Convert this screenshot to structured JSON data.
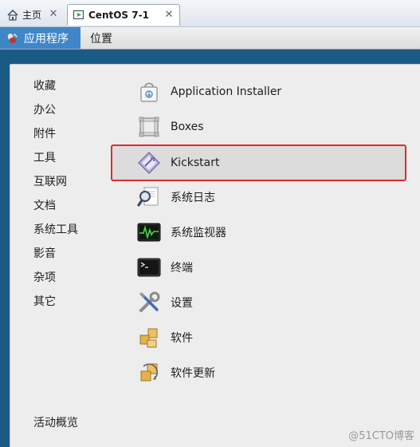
{
  "tabs": [
    {
      "label": "主页",
      "icon": "home-icon"
    },
    {
      "label": "CentOS 7-1",
      "icon": "vm-icon"
    }
  ],
  "topbar": {
    "applications_label": "应用程序",
    "places_label": "位置"
  },
  "categories": [
    "收藏",
    "办公",
    "附件",
    "工具",
    "互联网",
    "文档",
    "系统工具",
    "影音",
    "杂项",
    "其它"
  ],
  "activities_label": "活动概览",
  "apps": [
    {
      "label": "Application Installer",
      "icon": "shopping-bag-icon",
      "selected": false
    },
    {
      "label": "Boxes",
      "icon": "boxes-icon",
      "selected": false
    },
    {
      "label": "Kickstart",
      "icon": "kickstart-icon",
      "selected": true
    },
    {
      "label": "系统日志",
      "icon": "magnifier-icon",
      "selected": false
    },
    {
      "label": "系统监视器",
      "icon": "system-monitor-icon",
      "selected": false
    },
    {
      "label": "终端",
      "icon": "terminal-icon",
      "selected": false
    },
    {
      "label": "设置",
      "icon": "tools-icon",
      "selected": false
    },
    {
      "label": "软件",
      "icon": "software-icon",
      "selected": false
    },
    {
      "label": "软件更新",
      "icon": "software-update-icon",
      "selected": false
    }
  ],
  "watermark": "@51CTO博客",
  "colors": {
    "desktop": "#1c5a86",
    "apps_menu_active": "#3e86c8",
    "selection_border": "#e02c2c",
    "menu_background": "#ededed"
  }
}
